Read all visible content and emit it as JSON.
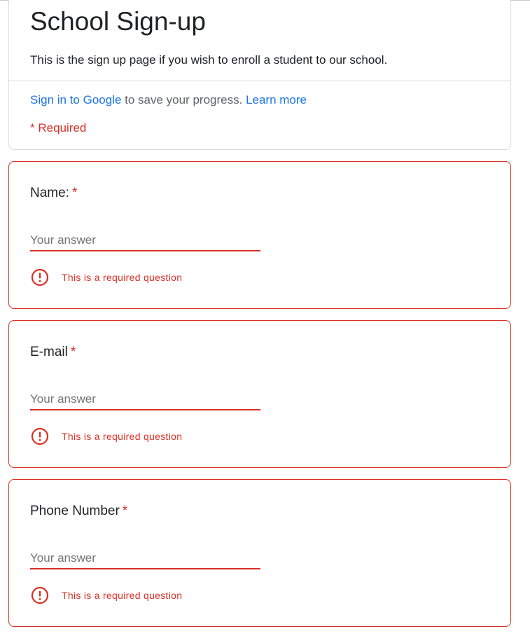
{
  "form": {
    "title": "School Sign-up",
    "description": "This is the sign up page if you wish to enroll a student to our school.",
    "signin_link": "Sign in to Google",
    "signin_text": " to save your progress. ",
    "learn_more_link": "Learn more",
    "required_note": "* Required"
  },
  "questions": [
    {
      "label": "Name:",
      "asterisk": "*",
      "placeholder": "Your answer",
      "value": "",
      "error": "This is a required question",
      "error_icon": "error-exclamation-icon"
    },
    {
      "label": "E-mail",
      "asterisk": "*",
      "placeholder": "Your answer",
      "value": "",
      "error": "This is a required question",
      "error_icon": "error-exclamation-icon"
    },
    {
      "label": "Phone Number",
      "asterisk": "*",
      "placeholder": "Your answer",
      "value": "",
      "error": "This is a required question",
      "error_icon": "error-exclamation-icon"
    }
  ],
  "colors": {
    "error": "#d93025",
    "link": "#1a73e8",
    "text": "#202124",
    "border": "#dadce0"
  }
}
